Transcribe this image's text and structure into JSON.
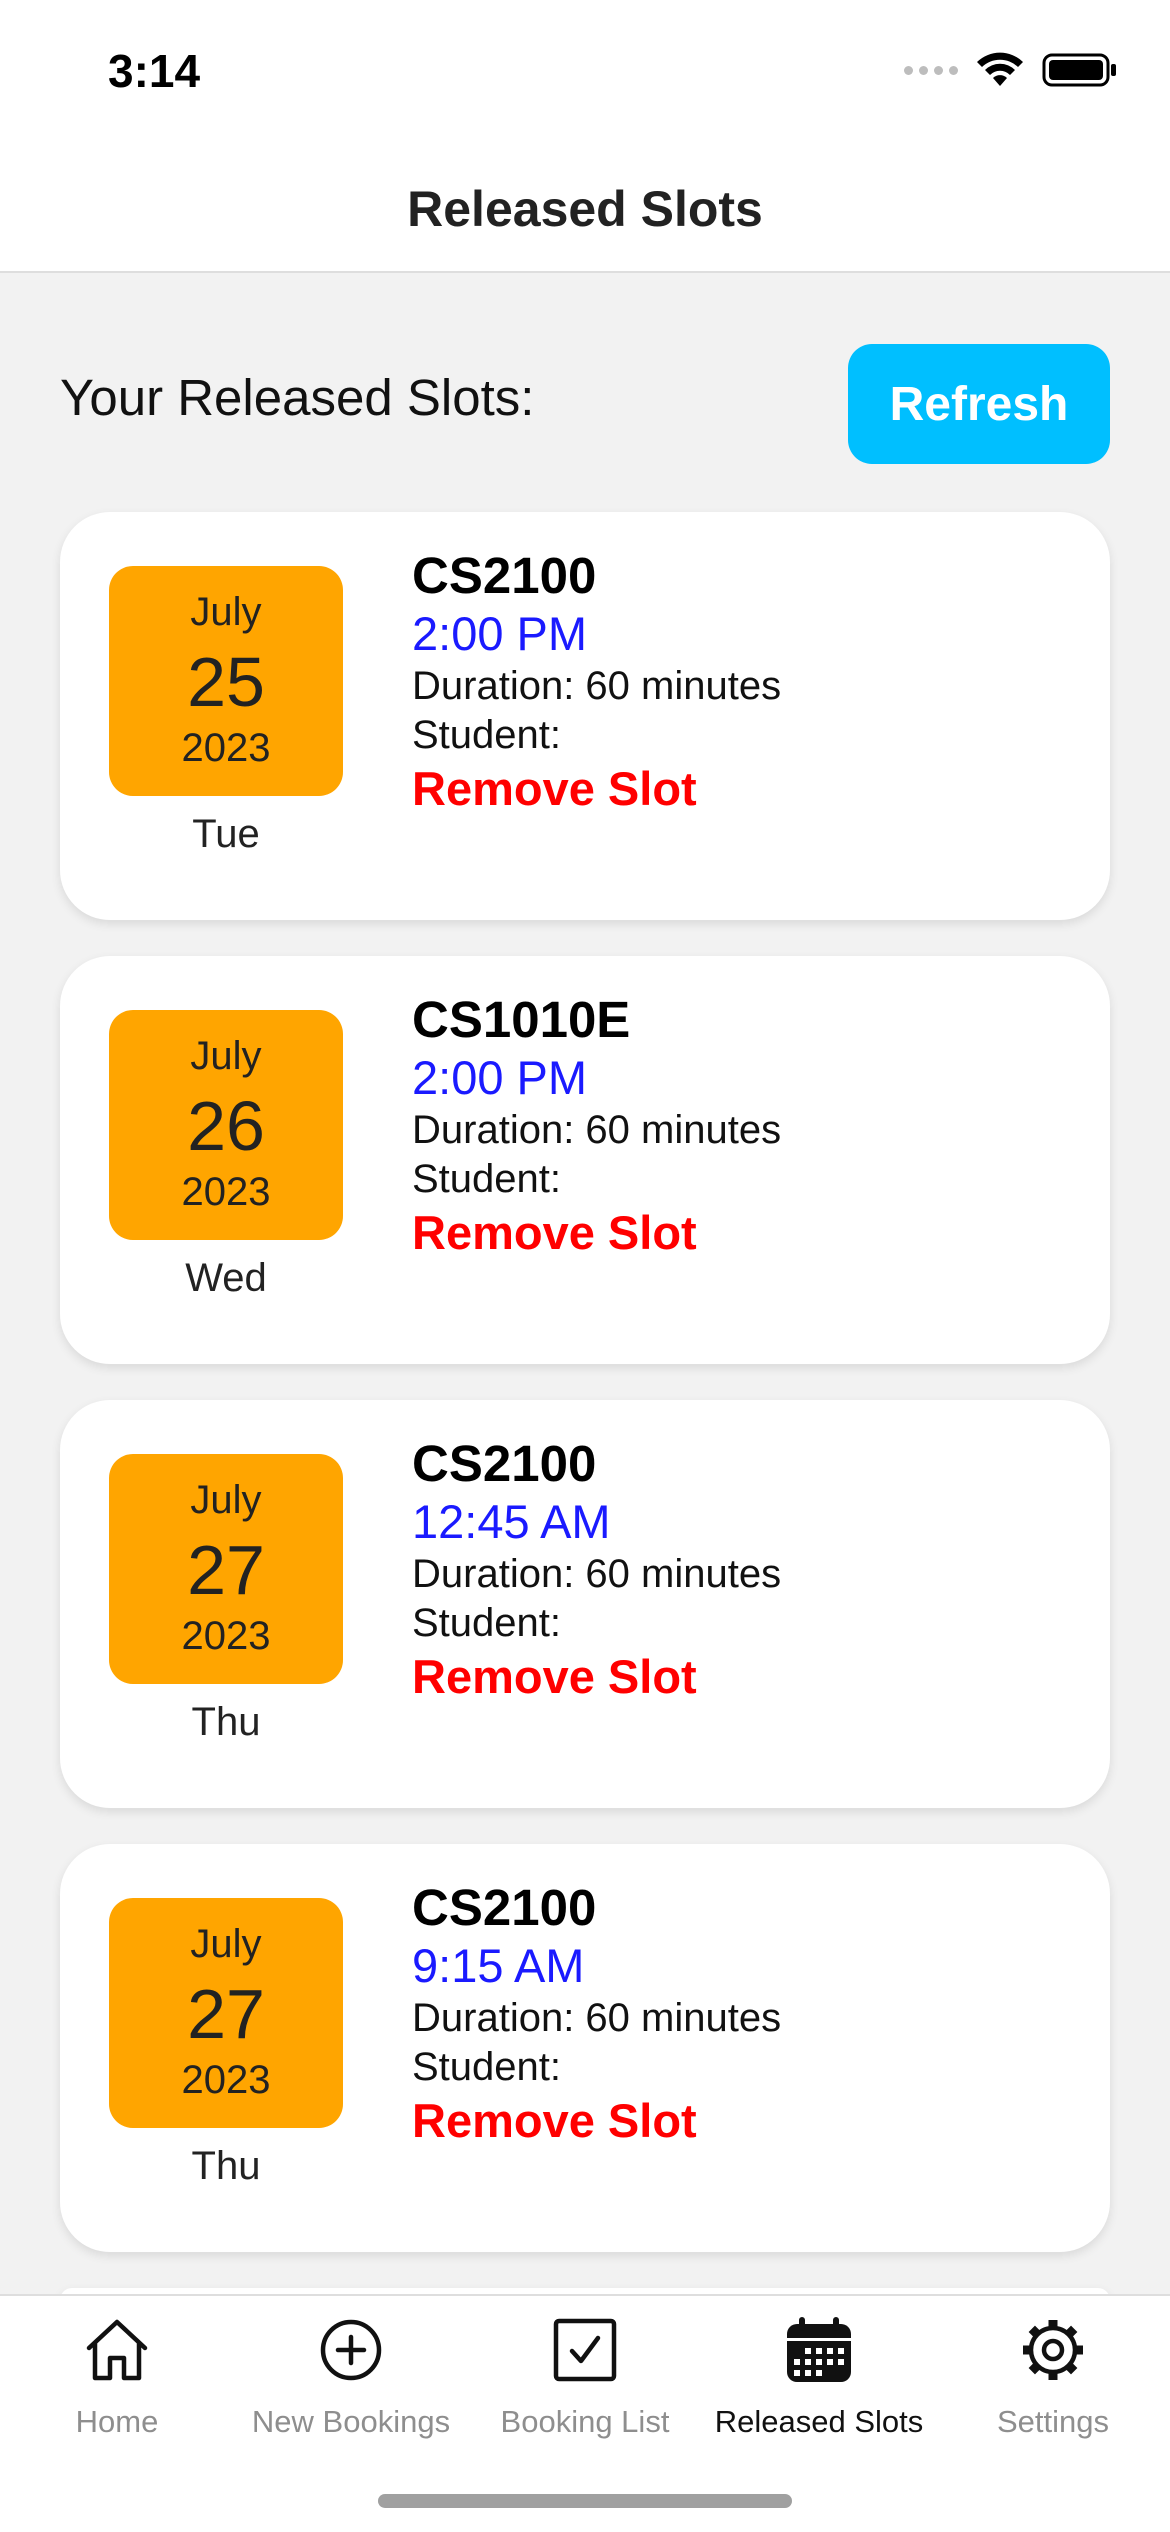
{
  "status_bar": {
    "time": "3:14"
  },
  "header": {
    "title": "Released Slots"
  },
  "section": {
    "heading": "Your Released Slots:",
    "refresh_label": "Refresh"
  },
  "slots": [
    {
      "month": "July",
      "day": "25",
      "year": "2023",
      "weekday": "Tue",
      "course": "CS2100",
      "time": "2:00 PM",
      "duration": "Duration: 60 minutes",
      "student": "Student:",
      "remove_label": "Remove Slot"
    },
    {
      "month": "July",
      "day": "26",
      "year": "2023",
      "weekday": "Wed",
      "course": "CS1010E",
      "time": "2:00 PM",
      "duration": "Duration: 60 minutes",
      "student": "Student:",
      "remove_label": "Remove Slot"
    },
    {
      "month": "July",
      "day": "27",
      "year": "2023",
      "weekday": "Thu",
      "course": "CS2100",
      "time": "12:45 AM",
      "duration": "Duration: 60 minutes",
      "student": "Student:",
      "remove_label": "Remove Slot"
    },
    {
      "month": "July",
      "day": "27",
      "year": "2023",
      "weekday": "Thu",
      "course": "CS2100",
      "time": "9:15 AM",
      "duration": "Duration: 60 minutes",
      "student": "Student:",
      "remove_label": "Remove Slot"
    }
  ],
  "tab_bar": {
    "items": [
      {
        "label": "Home",
        "icon": "home-icon"
      },
      {
        "label": "New Bookings",
        "icon": "plus-circle-icon"
      },
      {
        "label": "Booking List",
        "icon": "checkbox-icon"
      },
      {
        "label": "Released Slots",
        "icon": "calendar-icon"
      },
      {
        "label": "Settings",
        "icon": "gear-icon"
      }
    ],
    "active_index": 3
  },
  "colors": {
    "accent": "#00bfff",
    "date_tile": "#ffa500",
    "time_text": "#1a1aff",
    "remove_text": "#ff0000"
  }
}
